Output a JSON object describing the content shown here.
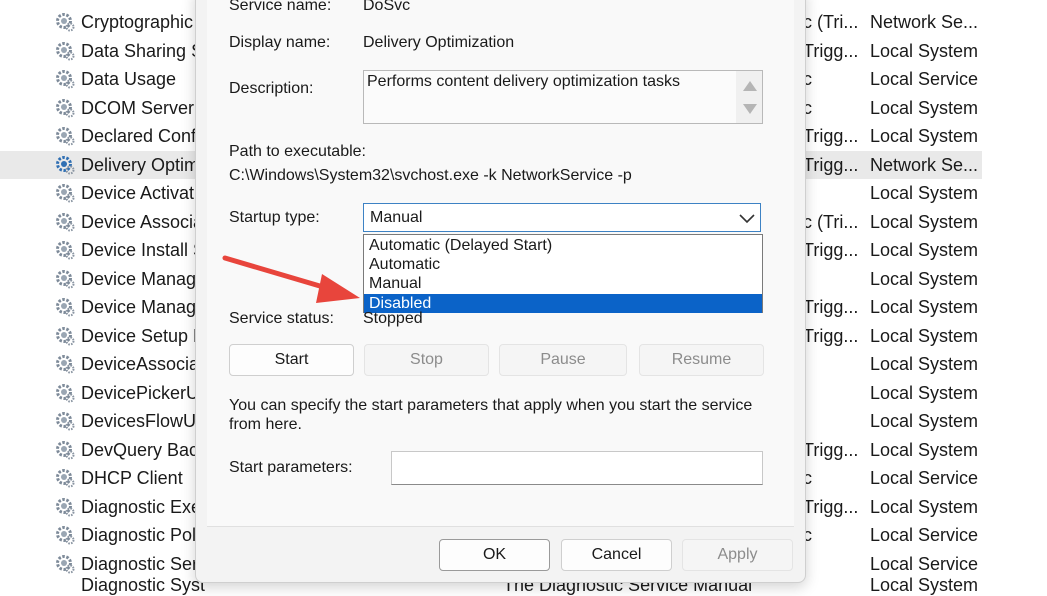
{
  "services": [
    {
      "name": "Cryptographic",
      "startup": "c (Tri...",
      "logon": "Network Se...",
      "selected": false
    },
    {
      "name": "Data Sharing S",
      "startup": "Trigg...",
      "logon": "Local System",
      "selected": false
    },
    {
      "name": "Data Usage",
      "startup": "c",
      "logon": "Local Service",
      "selected": false
    },
    {
      "name": "DCOM Server P",
      "startup": "c",
      "logon": "Local System",
      "selected": false
    },
    {
      "name": "Declared Confi",
      "startup": "Trigg...",
      "logon": "Local System",
      "selected": false
    },
    {
      "name": "Delivery Optim",
      "startup": "Trigg...",
      "logon": "Network Se...",
      "selected": true
    },
    {
      "name": "Device Activatio",
      "startup": "",
      "logon": "Local System",
      "selected": false
    },
    {
      "name": "Device Associat",
      "startup": "c (Tri...",
      "logon": "Local System",
      "selected": false
    },
    {
      "name": "Device Install S",
      "startup": "Trigg...",
      "logon": "Local System",
      "selected": false
    },
    {
      "name": "Device Manage",
      "startup": "",
      "logon": "Local System",
      "selected": false
    },
    {
      "name": "Device Manage",
      "startup": "Trigg...",
      "logon": "Local System",
      "selected": false
    },
    {
      "name": "Device Setup M",
      "startup": "Trigg...",
      "logon": "Local System",
      "selected": false
    },
    {
      "name": "DeviceAssociati",
      "startup": "",
      "logon": "Local System",
      "selected": false
    },
    {
      "name": "DevicePickerUs",
      "startup": "",
      "logon": "Local System",
      "selected": false
    },
    {
      "name": "DevicesFlowUs",
      "startup": "",
      "logon": "Local System",
      "selected": false
    },
    {
      "name": "DevQuery Back",
      "startup": "Trigg...",
      "logon": "Local System",
      "selected": false
    },
    {
      "name": "DHCP Client",
      "startup": "c",
      "logon": "Local Service",
      "selected": false
    },
    {
      "name": "Diagnostic Exe",
      "startup": "Trigg...",
      "logon": "Local System",
      "selected": false
    },
    {
      "name": "Diagnostic Poli",
      "startup": "c",
      "logon": "Local Service",
      "selected": false
    },
    {
      "name": "Diagnostic Serv",
      "startup": "",
      "logon": "Local Service",
      "selected": false
    }
  ],
  "partial_bottom_row": {
    "name": "Diagnostic Syst",
    "middle": "The Diagnostic Service Manual",
    "logon": "Local System"
  },
  "dialog": {
    "service_name_label": "Service name:",
    "service_name_value": "DoSvc",
    "display_name_label": "Display name:",
    "display_name_value": "Delivery Optimization",
    "description_label": "Description:",
    "description_value": "Performs content delivery optimization tasks",
    "path_label": "Path to executable:",
    "path_value": "C:\\Windows\\System32\\svchost.exe -k NetworkService -p",
    "startup_type_label": "Startup type:",
    "startup_type_value": "Manual",
    "startup_options": [
      {
        "label": "Automatic (Delayed Start)",
        "highlighted": false
      },
      {
        "label": "Automatic",
        "highlighted": false
      },
      {
        "label": "Manual",
        "highlighted": false
      },
      {
        "label": "Disabled",
        "highlighted": true
      }
    ],
    "service_status_label": "Service status:",
    "service_status_value": "Stopped",
    "buttons": {
      "start": "Start",
      "stop": "Stop",
      "pause": "Pause",
      "resume": "Resume"
    },
    "help_text_line1": "You can specify the start parameters that apply when you start the service",
    "help_text_line2": "from here.",
    "start_parameters_label": "Start parameters:",
    "start_parameters_value": "",
    "footer": {
      "ok": "OK",
      "cancel": "Cancel",
      "apply": "Apply"
    }
  },
  "colors": {
    "highlight": "#0b63c8",
    "annotation_arrow": "#e8453c",
    "selected_row": "#e9e9e9"
  },
  "icons": {
    "service": "gear-icon",
    "dropdown": "chevron-down-icon"
  }
}
